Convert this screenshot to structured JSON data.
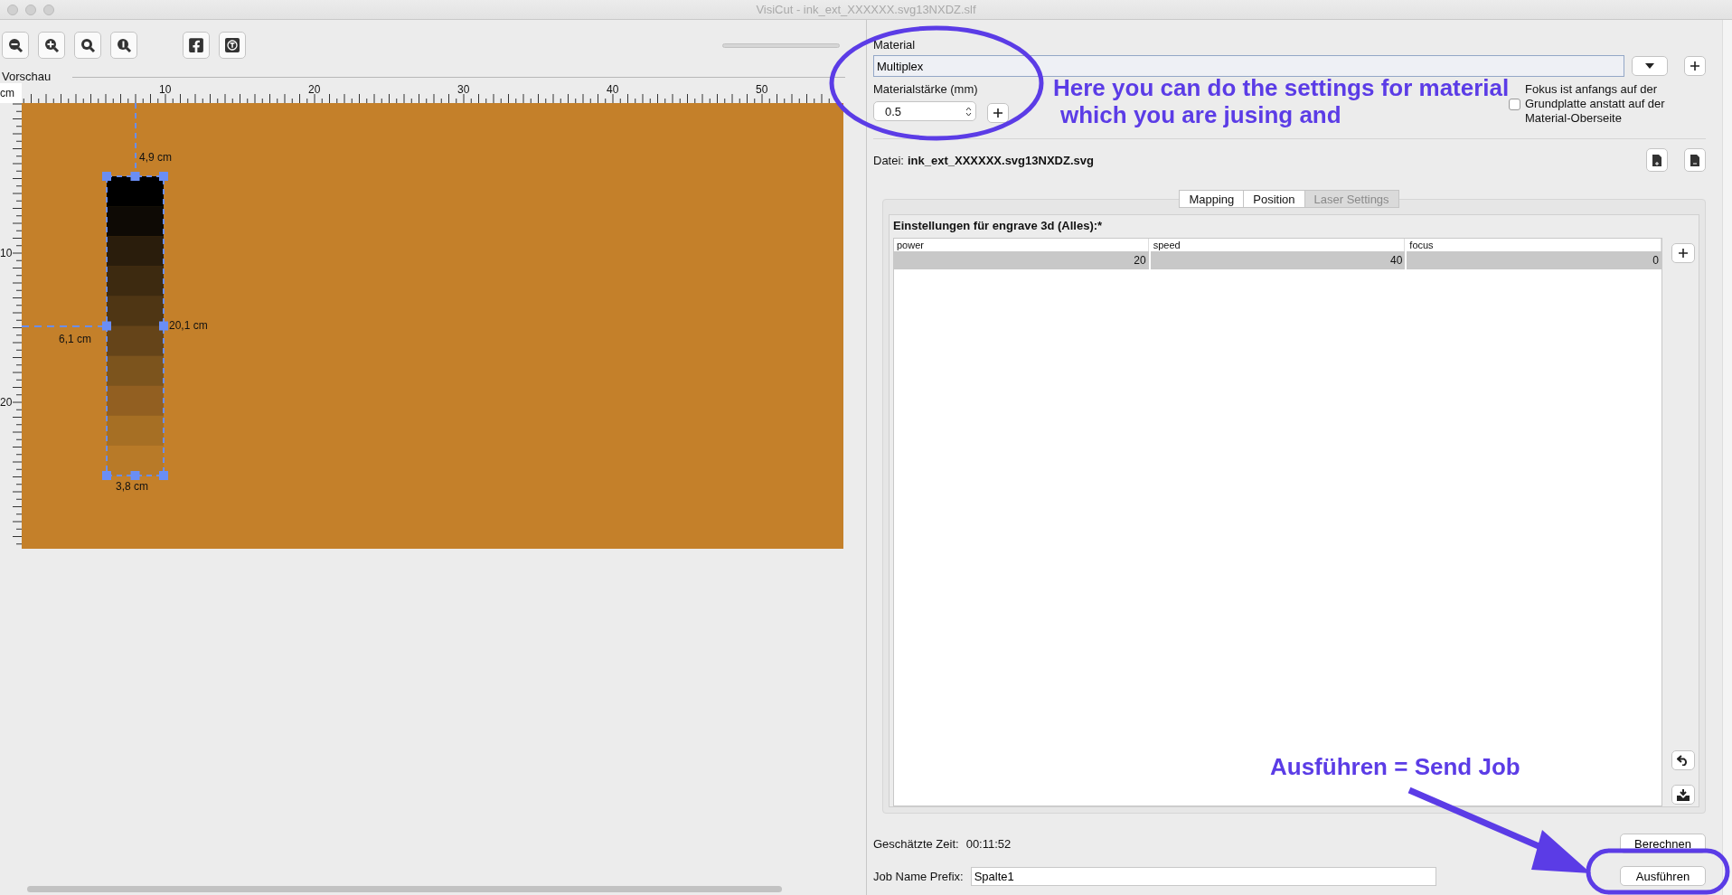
{
  "window": {
    "title": "VisiCut - ink_ext_XXXXXX.svg13NXDZ.slf"
  },
  "toolbar": {
    "zoom_slider": {
      "level": 0
    }
  },
  "preview": {
    "title": "Vorschau",
    "unit": "cm",
    "x_ticks": [
      "10",
      "20",
      "30",
      "40",
      "50"
    ],
    "y_ticks": [
      "10",
      "20"
    ],
    "dimensions": {
      "top": "4,9 cm",
      "right": "20,1 cm",
      "left": "6,1 cm",
      "bottom": "3,8 cm"
    }
  },
  "settings": {
    "material_label": "Material",
    "material": "Multiplex",
    "thickness_label": "Materialstärke (mm)",
    "thickness": "0.5",
    "focus_checkbox": {
      "label": "Fokus ist anfangs auf der Grundplatte anstatt auf der Material-Oberseite",
      "checked": false
    },
    "file_label": "Datei:",
    "file_name": "ink_ext_XXXXXX.svg13NXDZ.svg",
    "tabs": [
      {
        "label": "Mapping",
        "selected": false,
        "disabled": false
      },
      {
        "label": "Position",
        "selected": false,
        "disabled": false
      },
      {
        "label": "Laser Settings",
        "selected": true,
        "disabled": true
      }
    ],
    "table": {
      "title": "Einstellungen für engrave 3d (Alles):*",
      "columns": [
        "power",
        "speed",
        "focus"
      ],
      "rows": [
        {
          "cells": [
            "20",
            "40",
            "0"
          ],
          "selected": true
        }
      ]
    },
    "time_label": "Geschätzte Zeit:",
    "time": "00:11:52",
    "calculate_button": "Berechnen",
    "job_prefix_label": "Job Name Prefix:",
    "job_prefix": "Spalte1",
    "run_button": "Ausführen"
  },
  "annotations": {
    "material_note": [
      "Here you can do the settings for material",
      "which you are jusing and"
    ],
    "run_note": "Ausführen = Send Job"
  }
}
